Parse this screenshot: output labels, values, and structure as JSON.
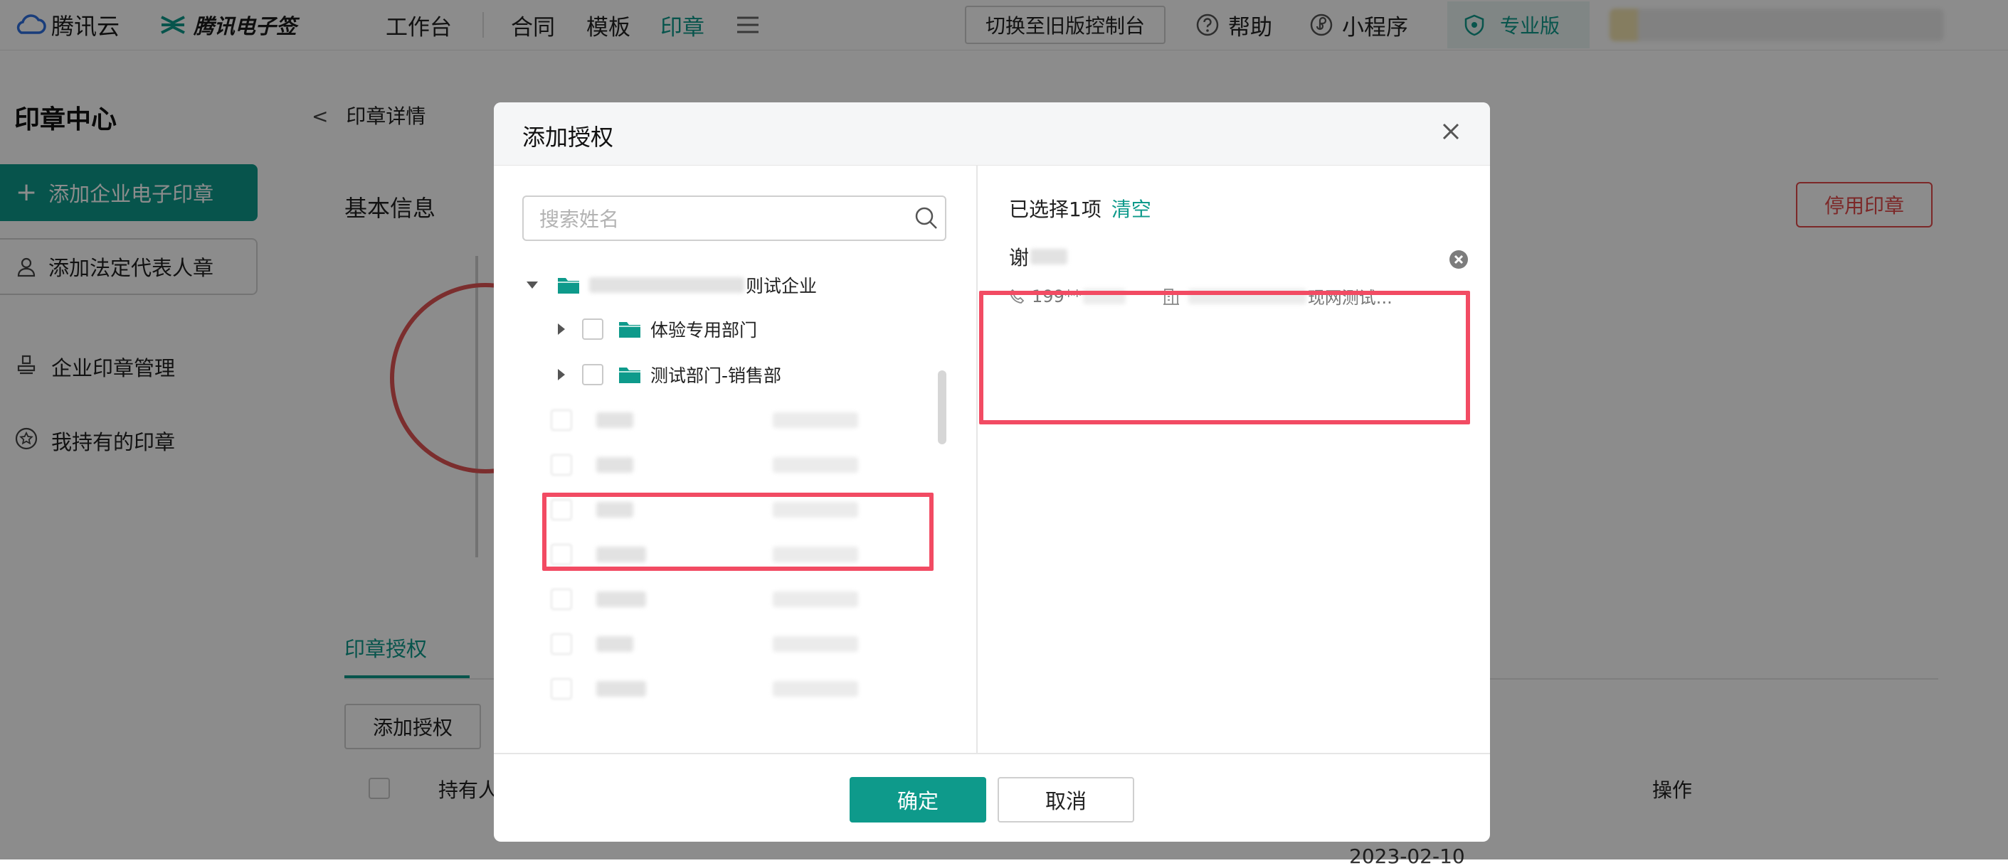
{
  "topbar": {
    "brand": "腾讯云",
    "product": "腾讯电子签",
    "nav": [
      "工作台",
      "合同",
      "模板",
      "印章"
    ],
    "nav_active_index": 3,
    "switch_button": "切换至旧版控制台",
    "help": "帮助",
    "miniprogram": "小程序",
    "edition": "专业版"
  },
  "sidebar": {
    "title": "印章中心",
    "primary_button": "添加企业电子印章",
    "secondary_button": "添加法定代表人章",
    "links": [
      "企业印章管理",
      "我持有的印章"
    ]
  },
  "main": {
    "breadcrumb": "印章详情",
    "section_title": "基本信息",
    "stop_button": "停用印章",
    "tab": "印章授权",
    "add_auth_button": "添加授权",
    "table_headers": {
      "holder": "持有人",
      "actions": "操作"
    },
    "date_cell": "2023-02-10"
  },
  "modal": {
    "title": "添加授权",
    "search_placeholder": "搜索姓名",
    "tree": {
      "root_suffix": "则试企业",
      "departments": [
        "体验专用部门",
        "测试部门-销售部"
      ]
    },
    "selected": {
      "summary": "已选择1项",
      "clear": "清空",
      "name_visible": "谢",
      "phone_prefix": "199**",
      "org_suffix": "现网测试..."
    },
    "ok_button": "确定",
    "cancel_button": "取消"
  },
  "colors": {
    "accent": "#0e9a8b",
    "danger": "#e24a4a",
    "highlight": "#f24b63"
  }
}
